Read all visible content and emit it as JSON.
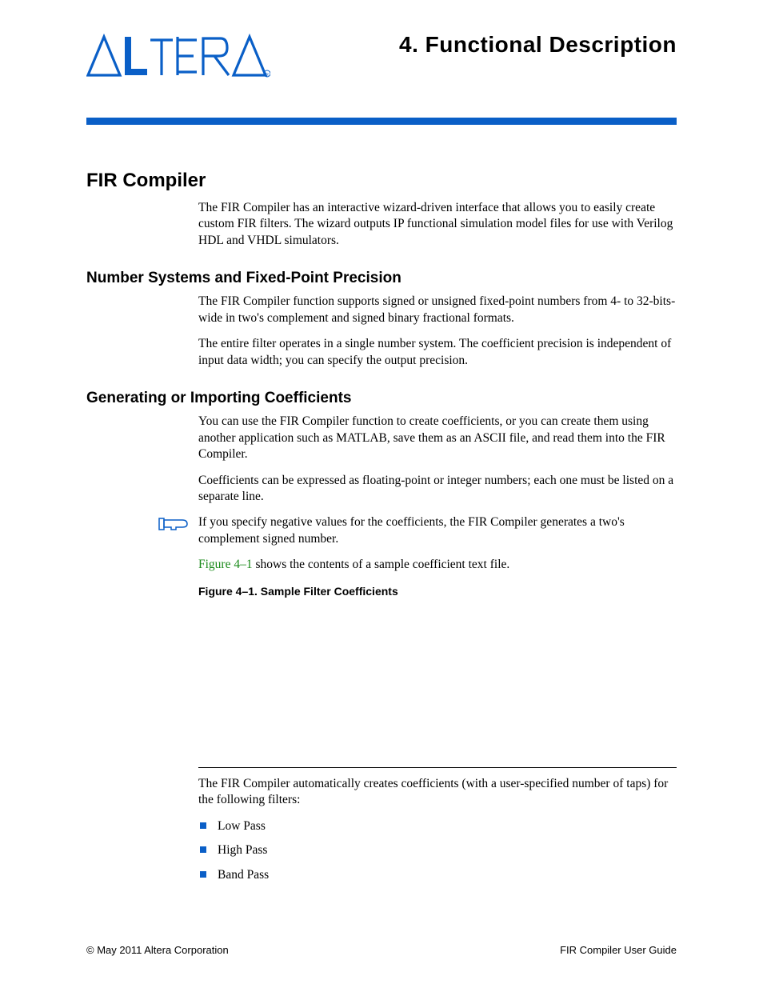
{
  "header": {
    "chapter_title": "4.  Functional Description"
  },
  "sections": {
    "h1": "FIR Compiler",
    "intro_para": "The FIR Compiler has an interactive wizard-driven interface that allows you to easily create custom FIR filters. The wizard outputs IP functional simulation model files for use with Verilog HDL and VHDL simulators.",
    "h2_num": "Number Systems and Fixed-Point Precision",
    "num_p1": "The FIR Compiler function supports signed or unsigned fixed-point numbers from 4- to 32-bits-wide in two's complement and signed binary fractional formats.",
    "num_p2": "The entire filter operates in a single number system. The coefficient precision is independent of input data width; you can specify the output precision.",
    "h2_coef": "Generating or Importing Coefficients",
    "coef_p1": "You can use the FIR Compiler function to create coefficients, or you can create them using another application such as MATLAB, save them as an ASCII file, and read them into the FIR Compiler.",
    "coef_p2": "Coefficients can be expressed as floating-point or integer numbers; each one must be listed on a separate line.",
    "note": "If you specify negative values for the coefficients, the FIR Compiler generates a two's complement signed number.",
    "fig_ref": "Figure 4–1",
    "fig_sentence_rest": " shows the contents of a sample coefficient text file.",
    "fig_title": "Figure 4–1. Sample Filter Coefficients",
    "after_fig_para": "The FIR Compiler automatically creates coefficients (with a user-specified number of taps) for the following filters:",
    "bullets": [
      "Low Pass",
      "High Pass",
      "Band Pass"
    ]
  },
  "footer": {
    "left": "© May 2011   Altera Corporation",
    "right": "FIR Compiler User Guide"
  }
}
